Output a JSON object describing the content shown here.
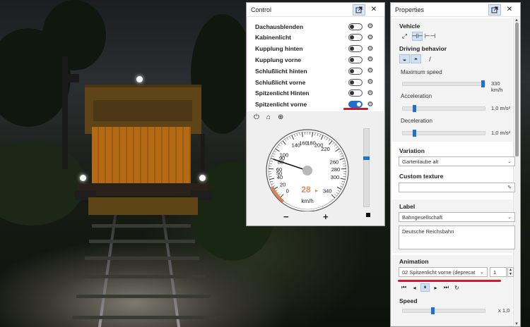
{
  "scene": {
    "description_icon": "locomotive-3d-view"
  },
  "control": {
    "title": "Control",
    "popout_icon": "popout-icon",
    "close_label": "✕",
    "toggles": [
      {
        "label": "Dachausblenden",
        "on": false
      },
      {
        "label": "Kabinenlicht",
        "on": false
      },
      {
        "label": "Kupplung hinten",
        "on": false
      },
      {
        "label": "Kupplung vorne",
        "on": false
      },
      {
        "label": "Schlußlicht hinten",
        "on": false
      },
      {
        "label": "Schlußlicht vorne",
        "on": false
      },
      {
        "label": "Spitzenlicht Hinten",
        "on": false
      },
      {
        "label": "Spitzenlicht vorne",
        "on": true
      }
    ],
    "gauge": {
      "ticks": [
        "0",
        "20",
        "40",
        "50",
        "60",
        "80",
        "90",
        "100",
        "140",
        "160",
        "180",
        "200",
        "220",
        "260",
        "280",
        "300",
        "340"
      ],
      "speed": "28",
      "speed_arrow": "▸",
      "unit": "km/h",
      "minus": "−",
      "plus": "+"
    },
    "throttle_fraction": 0.35
  },
  "properties": {
    "title": "Properties",
    "popout_icon": "popout-icon",
    "close_label": "✕",
    "vehicle_label": "Vehicle",
    "driving_behavior_label": "Driving behavior",
    "max_speed_label": "Maximum speed",
    "max_speed_value": "330 km/h",
    "max_speed_fraction": 0.97,
    "acceleration_label": "Acceleration",
    "acceleration_value": "1,0 m/s²",
    "acceleration_fraction": 0.14,
    "deceleration_label": "Deceleration",
    "deceleration_value": "1,0 m/s²",
    "deceleration_fraction": 0.14,
    "variation_label": "Variation",
    "variation_value": "Gartenlaube alt",
    "custom_texture_label": "Custom texture",
    "custom_texture_value": "",
    "label_label": "Label",
    "label_select_value": "Bahngesellschaft",
    "label_text": "Deutsche Reichsbahn",
    "animation_label": "Animation",
    "animation_value": "02 Spitzenlicht vorne (deprecat",
    "animation_count": "1",
    "speed_label": "Speed",
    "speed_value": "x 1,0",
    "speed_fraction": 0.36,
    "accent_color": "#1e73c8",
    "highlight_color": "#d0192b"
  }
}
